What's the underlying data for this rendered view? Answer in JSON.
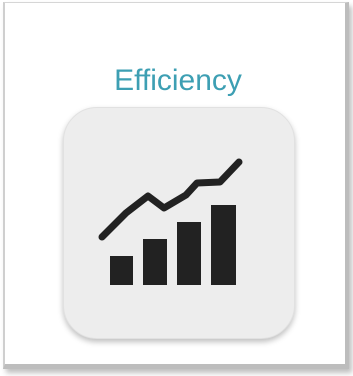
{
  "app_tile": {
    "title": "Efficiency",
    "title_color": "#3d9fb3",
    "icon": "growth-chart-icon",
    "icon_color": "#222222",
    "tile_background": "#ededed"
  }
}
